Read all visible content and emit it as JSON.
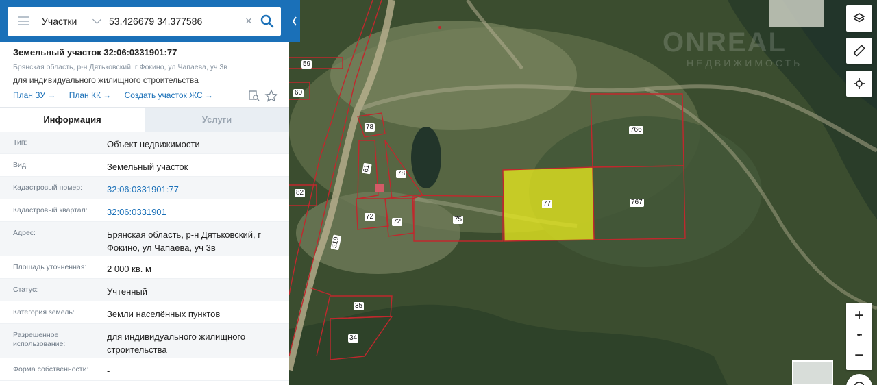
{
  "search": {
    "layer": "Участки",
    "query": "53.426679 34.377586",
    "clear": "×"
  },
  "object": {
    "title": "Земельный участок 32:06:0331901:77",
    "address": "Брянская область, р-н Дятьковский, г Фокино, ул Чапаева, уч 3в",
    "use": "для индивидуального жилищного строительства",
    "links": [
      "План ЗУ →",
      "План КК →",
      "Создать участок ЖС →"
    ]
  },
  "tabs": {
    "info": "Информация",
    "services": "Услуги"
  },
  "rows": [
    {
      "label": "Тип:",
      "value": "Объект недвижимости"
    },
    {
      "label": "Вид:",
      "value": "Земельный участок"
    },
    {
      "label": "Кадастровый номер:",
      "value": "32:06:0331901:77"
    },
    {
      "label": "Кадастровый квартал:",
      "value": "32:06:0331901"
    },
    {
      "label": "Адрес:",
      "value": "Брянская область, р-н Дятьковский, г Фокино, ул Чапаева, уч 3в"
    },
    {
      "label": "Площадь уточненная:",
      "value": "2 000 кв. м"
    },
    {
      "label": "Статус:",
      "value": "Учтенный"
    },
    {
      "label": "Категория земель:",
      "value": "Земли населённых пунктов"
    },
    {
      "label": "Разрешенное использование:",
      "value": "для индивидуального жилищного строительства"
    },
    {
      "label": "Форма собственности:",
      "value": "-"
    }
  ],
  "map": {
    "parcel_labels": [
      "59",
      "60",
      "78",
      "61",
      "78",
      "82",
      "72",
      "72",
      "75",
      "77",
      "766",
      "767",
      "519",
      "35",
      "34"
    ],
    "watermark": "ONREAL",
    "watermark_sub": "НЕДВИЖИМОСТЬ",
    "zoom_in": "+",
    "zoom_more": "•••",
    "zoom_out": "−",
    "colors": {
      "parcel_border": "#c0282d",
      "selected_fill": "#e6e81f",
      "panel_blue": "#1a70b8"
    }
  }
}
